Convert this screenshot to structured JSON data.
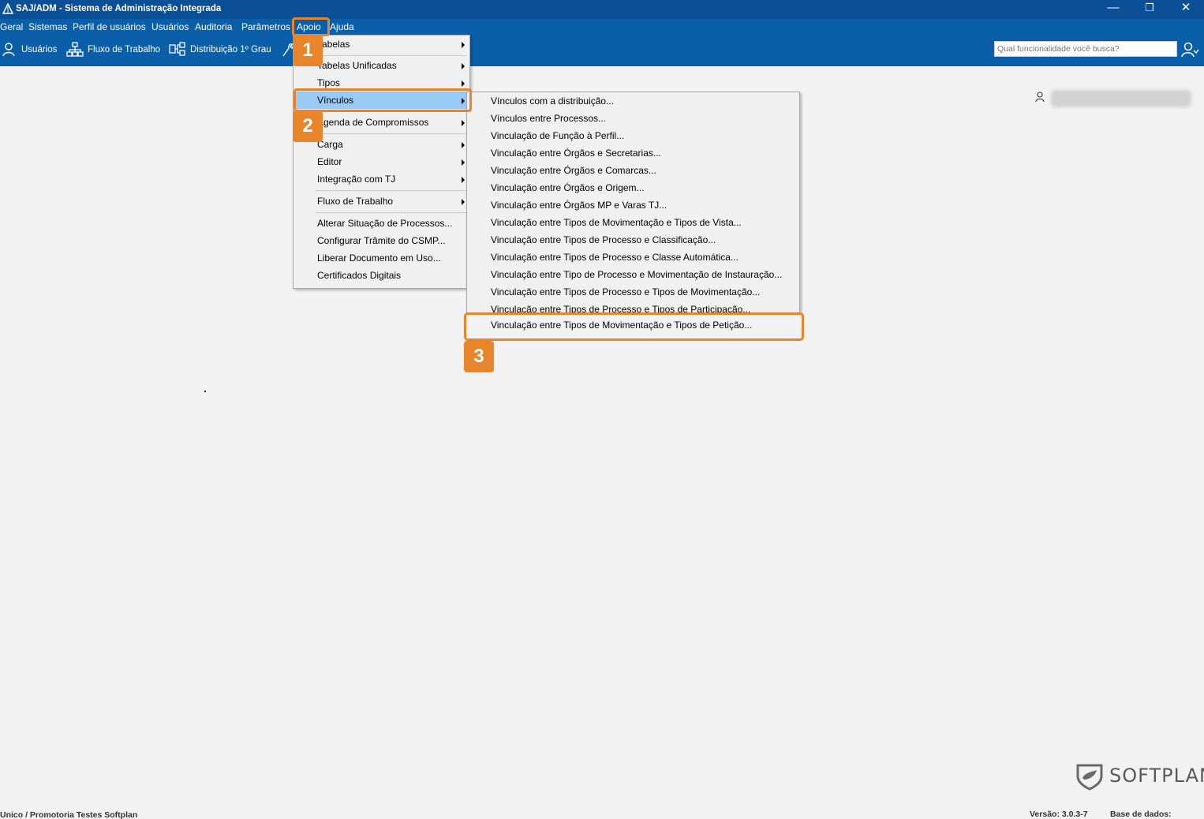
{
  "window": {
    "title": "SAJ/ADM - Sistema de Administração Integrada",
    "minimize": "—",
    "restore": "❐",
    "close": "✕"
  },
  "menubar": [
    "Geral",
    "Sistemas",
    "Perfil de usuários",
    "Usuários",
    "Auditoria",
    "Parâmetros",
    "Apoio",
    "Ajuda"
  ],
  "toolbar": {
    "usuarios": "Usuários",
    "fluxo": "Fluxo de Trabalho",
    "distribuicao": "Distribuição 1º Grau"
  },
  "search": {
    "placeholder": "Qual funcionalidade você busca?"
  },
  "apoio_menu": [
    "Tabelas",
    "Tabelas Unificadas",
    "Tipos",
    "Vínculos",
    "Agenda de Compromissos",
    "Carga",
    "Editor",
    "Integração com TJ",
    "Fluxo de Trabalho",
    "Alterar Situação de Processos...",
    "Configurar Trâmite do CSMP...",
    "Liberar Documento em Uso...",
    "Certificados Digitais"
  ],
  "vinculos_menu": [
    "Vínculos com a distribuição...",
    "Vínculos entre Processos...",
    "Vinculação de Função à Perfil...",
    "Vinculação entre Órgãos e Secretarias...",
    "Vinculação entre Órgãos e Comarcas...",
    "Vinculação entre Órgãos e Origem...",
    "Vinculação entre Órgãos MP e Varas TJ...",
    "Vinculação entre Tipos de Movimentação e Tipos de Vista...",
    "Vinculação entre Tipos de Processo e Classificação...",
    "Vinculação entre Tipos de Processo e Classe Automática...",
    "Vinculação entre Tipo de Processo e Movimentação de Instauração...",
    "Vinculação entre Tipos de Processo e Tipos de Movimentação...",
    "Vinculação entre Tipos de Processo e Tipos de Participação...",
    "Vinculação entre Tipos de Movimentação e Tipos de Petição..."
  ],
  "callouts": [
    "1",
    "2",
    "3"
  ],
  "footer": {
    "org": "Unico / Promotoria Testes Softplan",
    "version": "Versão: 3.0.3-7",
    "database": "Base de dados:",
    "logo": "SOFTPLAN"
  },
  "colors": {
    "titlebar": "#0b4f97",
    "menubar": "#0b5ea8",
    "highlight": "#e8852a",
    "active_item": "#99c9f5"
  }
}
